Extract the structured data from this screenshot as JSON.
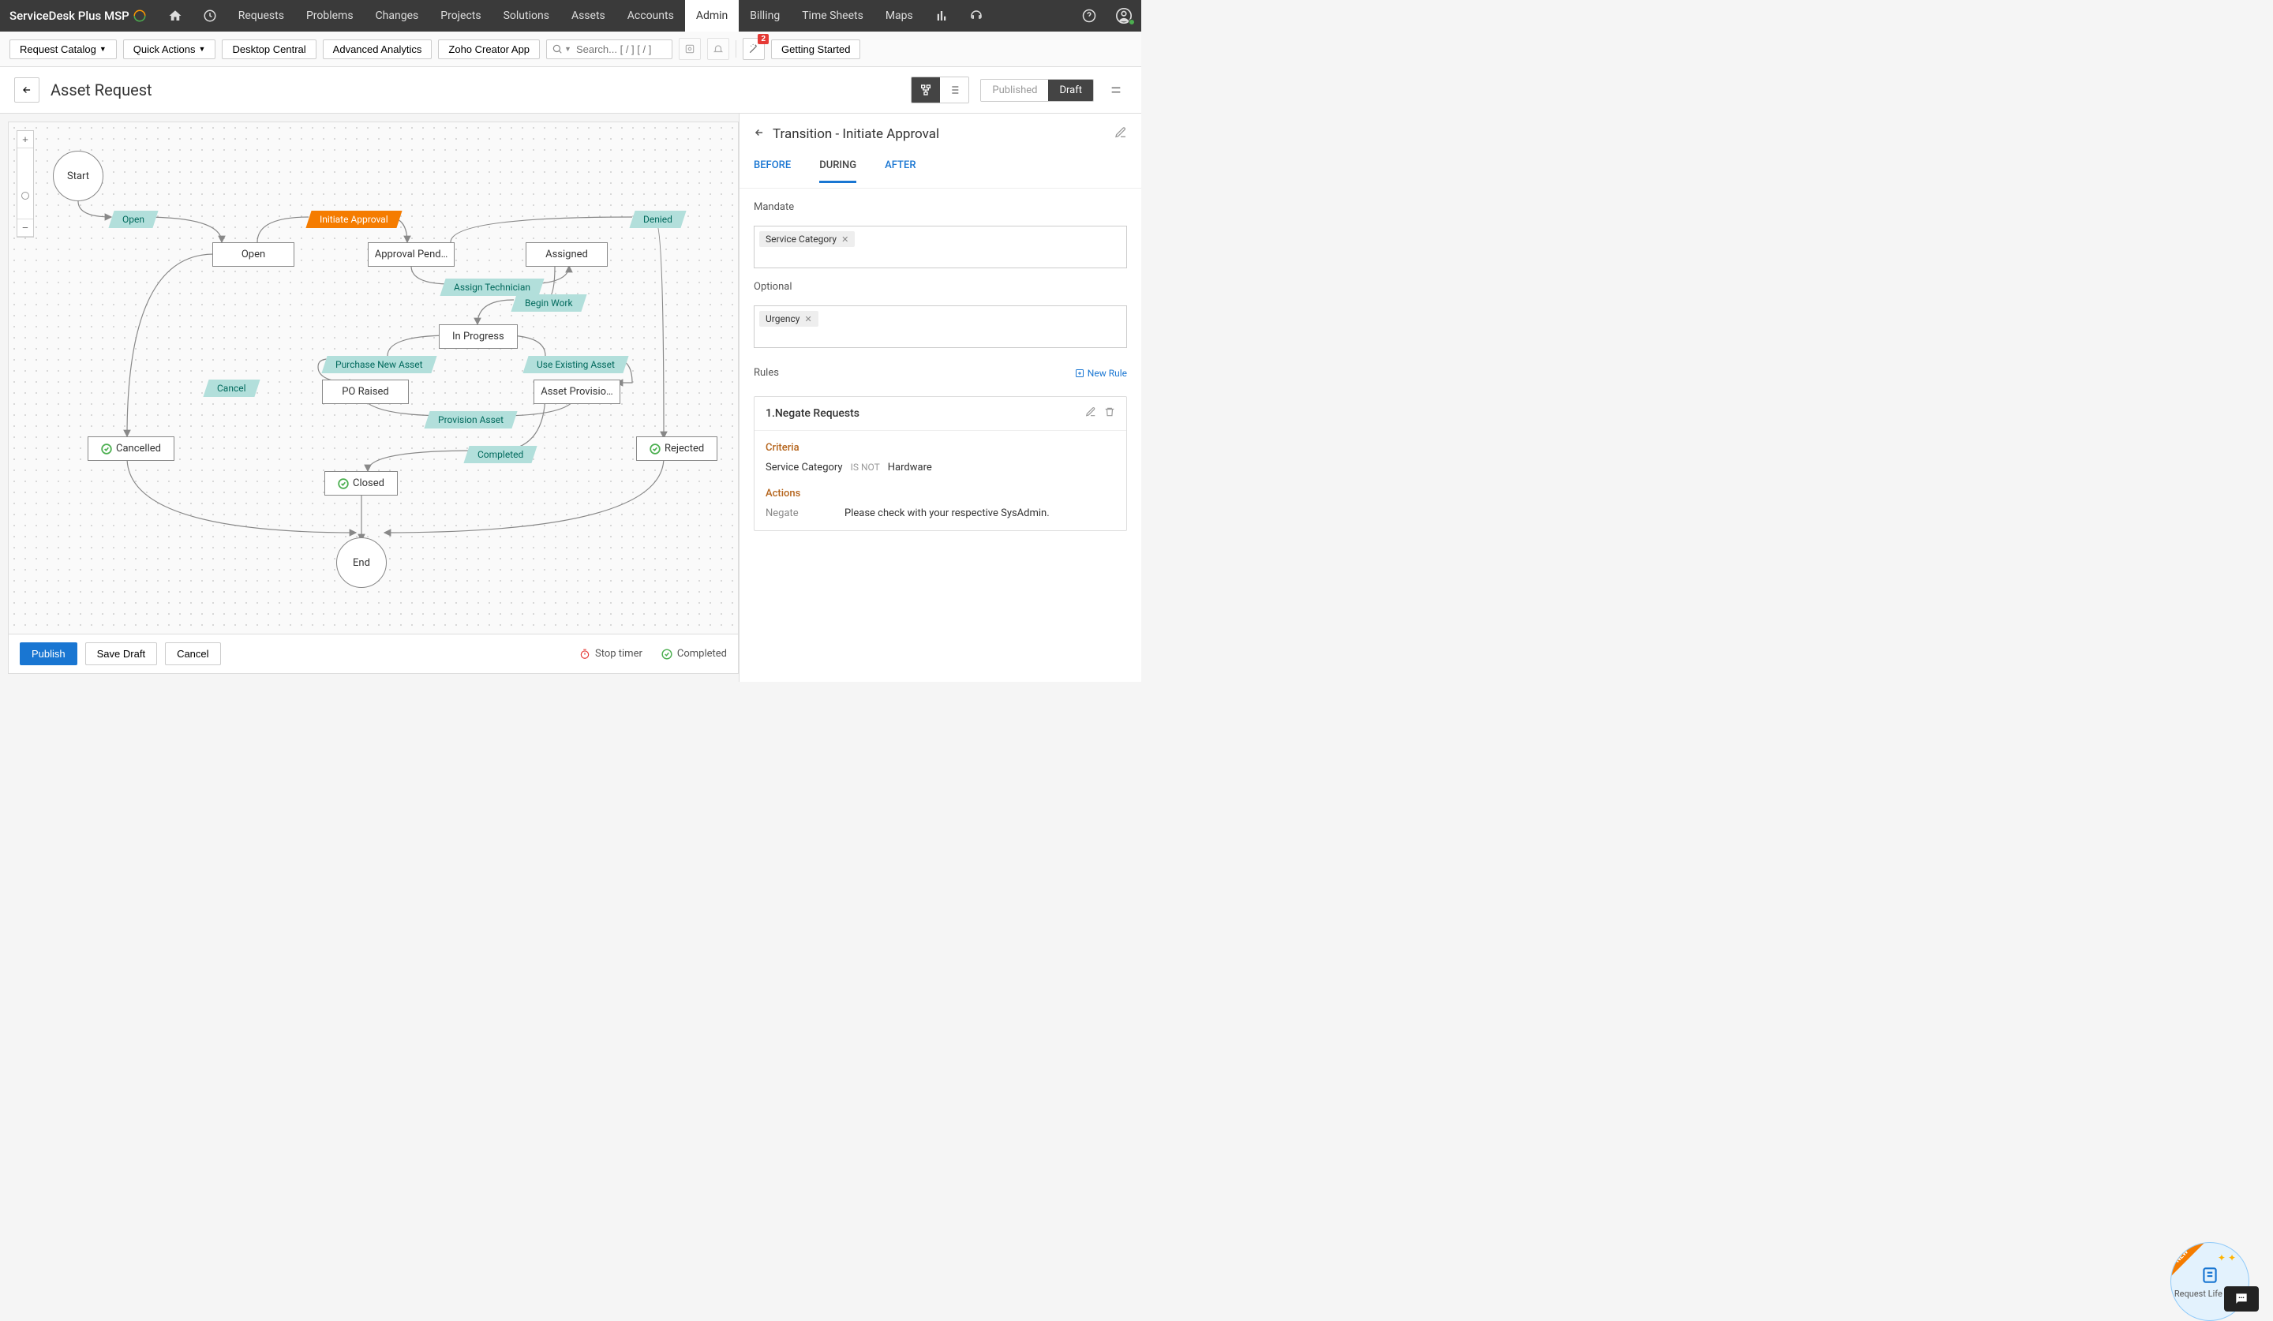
{
  "brand": "ServiceDesk Plus MSP",
  "topnav": [
    "Requests",
    "Problems",
    "Changes",
    "Projects",
    "Solutions",
    "Assets",
    "Accounts",
    "Admin",
    "Billing",
    "Time Sheets",
    "Maps"
  ],
  "topnav_active": "Admin",
  "secondary": {
    "request_catalog": "Request Catalog",
    "quick_actions": "Quick Actions",
    "desktop_central": "Desktop Central",
    "advanced_analytics": "Advanced Analytics",
    "zoho_creator": "Zoho Creator App",
    "search_placeholder": "Search... [ / ] [ / ]",
    "wand_badge": "2",
    "getting_started": "Getting Started"
  },
  "page": {
    "title": "Asset Request",
    "published": "Published",
    "draft": "Draft"
  },
  "diagram": {
    "start": "Start",
    "end": "End",
    "nodes": {
      "open": "Open",
      "approval_pending": "Approval Pend…",
      "assigned": "Assigned",
      "in_progress": "In Progress",
      "po_raised": "PO Raised",
      "asset_provisioned": "Asset Provisio…",
      "cancelled": "Cancelled",
      "closed": "Closed",
      "rejected": "Rejected"
    },
    "transitions": {
      "open_t": "Open",
      "initiate_approval": "Initiate Approval",
      "denied": "Denied",
      "assign_technician": "Assign Technician",
      "begin_work": "Begin Work",
      "purchase_new_asset": "Purchase New Asset",
      "use_existing_asset": "Use Existing Asset",
      "provision_asset": "Provision Asset",
      "completed": "Completed",
      "cancel": "Cancel"
    }
  },
  "footer": {
    "publish": "Publish",
    "save_draft": "Save Draft",
    "cancel": "Cancel",
    "stop_timer": "Stop timer",
    "completed": "Completed"
  },
  "panel": {
    "title": "Transition - Initiate Approval",
    "tabs": {
      "before": "BEFORE",
      "during": "DURING",
      "after": "AFTER"
    },
    "mandate_label": "Mandate",
    "mandate_tags": [
      "Service Category"
    ],
    "optional_label": "Optional",
    "optional_tags": [
      "Urgency"
    ],
    "rules_label": "Rules",
    "new_rule": "New Rule",
    "rule": {
      "title": "1.Negate Requests",
      "criteria_label": "Criteria",
      "criteria_field": "Service Category",
      "criteria_op": "IS NOT",
      "criteria_val": "Hardware",
      "actions_label": "Actions",
      "action_name": "Negate",
      "action_msg": "Please check with your respective SysAdmin."
    }
  },
  "widget": {
    "label": "Request Life Cycle",
    "corner": "NEW"
  }
}
